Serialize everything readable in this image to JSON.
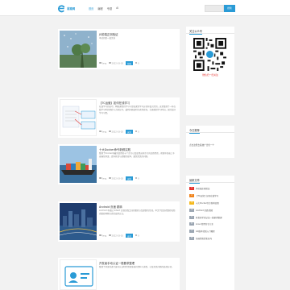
{
  "header": {
    "logo_text": "易猿网",
    "nav": [
      "首页",
      "编程",
      "专题",
      "AI"
    ],
    "search_placeholder": "",
    "search_button": "搜索"
  },
  "posts": [
    {
      "title": "JS前端正则验证",
      "desc": "本站的第一篇文章",
      "author": "Yang",
      "date": "2022-03-30",
      "tag": "前端",
      "views": "0"
    },
    {
      "title": "【TC运营】如何在线学习",
      "desc": "在线学习的技巧：网络课程的学习与传统课堂学习方式有很大区别，这里整理了一些在线学习时的经验与大家分享。遇到问题及时向老师咨询，合理规划学习时间，保持良好学习习惯。",
      "author": "Yang",
      "date": "2022-03-20",
      "tag": "运营",
      "views": "0"
    },
    {
      "title": "十大Docker命令新鲜实践",
      "desc": "整理了Docker中最常使用的十个命令以及使用这些命令的实践经验，帮助你快速上手容器化开发，提升开发与部署的效率，避免常见的问题。",
      "author": "Yang",
      "date": "2022-03-18",
      "tag": "运维",
      "views": "0"
    },
    {
      "title": "Android 页面 跳转",
      "desc": "Android 中通过 Intent 实现页面之间的跳转以及参数的传递，本文介绍显式跳转和隐式跳转两种方式的使用方法。",
      "author": "Yang",
      "date": "2022-03-10",
      "tag": "安卓",
      "views": "0"
    },
    {
      "title": "开发者手动认证一般要求整理",
      "desc": "整理了开发者进行身份认证时所需要准备的资料与流程，以及常见问题的处理方式。",
      "author": "Yang",
      "date": "2022-03-01",
      "tag": "开发",
      "views": "0"
    }
  ],
  "sidebar": {
    "follow": {
      "title": "关注公众号",
      "caption": "微信扫一扫关注"
    },
    "ad": {
      "title": "今日推荐",
      "text": "点击这里去投放广告位一个"
    },
    "hot": {
      "title": "最新文章",
      "items": [
        "JS前端正则验证",
        "【TC运营】如何在线学习",
        "十大Docker命令新鲜实践",
        "Android 页面 跳转",
        "开发者手动认证一般要求整理",
        "Linux常用命令大全",
        "Git版本控制入门教程",
        "前端性能优化技巧"
      ],
      "colors": [
        "#e5322d",
        "#f0841d",
        "#f5b91c",
        "#9aa5b1",
        "#9aa5b1",
        "#9aa5b1",
        "#9aa5b1",
        "#9aa5b1"
      ]
    }
  },
  "colors": {
    "accent": "#2a9bd6"
  }
}
